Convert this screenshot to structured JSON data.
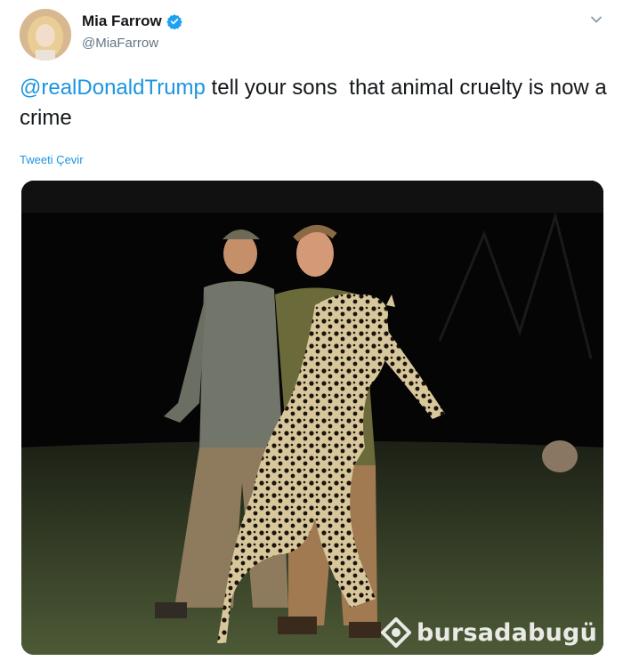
{
  "tweet": {
    "author_name": "Mia Farrow",
    "author_handle": "@MiaFarrow",
    "mention": "@realDonaldTrump",
    "text": " tell your sons  that animal cruelty is now a crime",
    "translate_label": "Tweeti Çevir"
  },
  "media": {
    "watermark_text": "bursadabugü"
  },
  "icons": {
    "verified": "verified-badge-icon",
    "menu": "chevron-down-icon",
    "watermark_logo": "bursadabugun-logo-icon"
  },
  "colors": {
    "link": "#1b95e0",
    "text": "#14171a",
    "secondary": "#657786"
  }
}
